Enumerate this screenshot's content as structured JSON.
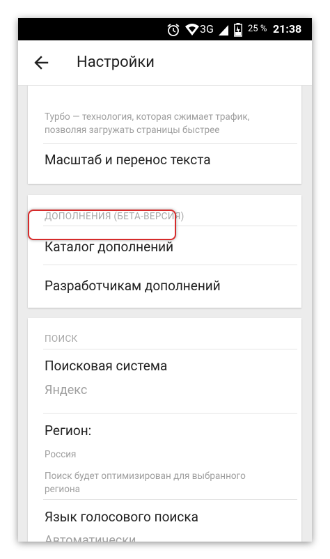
{
  "status_bar": {
    "battery_percent": "25 %",
    "network": "3G",
    "time": "21:38"
  },
  "app_bar": {
    "title": "Настройки"
  },
  "turbo_card": {
    "description": "Турбо — технология, которая сжимает трафик, позволяя загружать страницы быстрее",
    "scale_item": "Масштаб и перенос текста"
  },
  "addons_card": {
    "section_title": "ДОПОЛНЕНИЯ (БЕТА-ВЕРСИЯ)",
    "catalog_item": "Каталог дополнений",
    "developers_item": "Разработчикам дополнений"
  },
  "search_card": {
    "section_title": "ПОИСК",
    "engine_label": "Поисковая система",
    "engine_value": "Яндекс",
    "region_label": "Регион:",
    "region_value": "Россия",
    "region_hint": "Поиск будет оптимизирован для выбранного региона",
    "voice_label": "Язык голосового поиска",
    "voice_value": "Автоматически"
  },
  "icons": {
    "back": "arrow-left-icon",
    "alarm": "alarm-icon",
    "wifi": "wifi-icon",
    "signal": "signal-icon",
    "battery": "battery-icon"
  }
}
